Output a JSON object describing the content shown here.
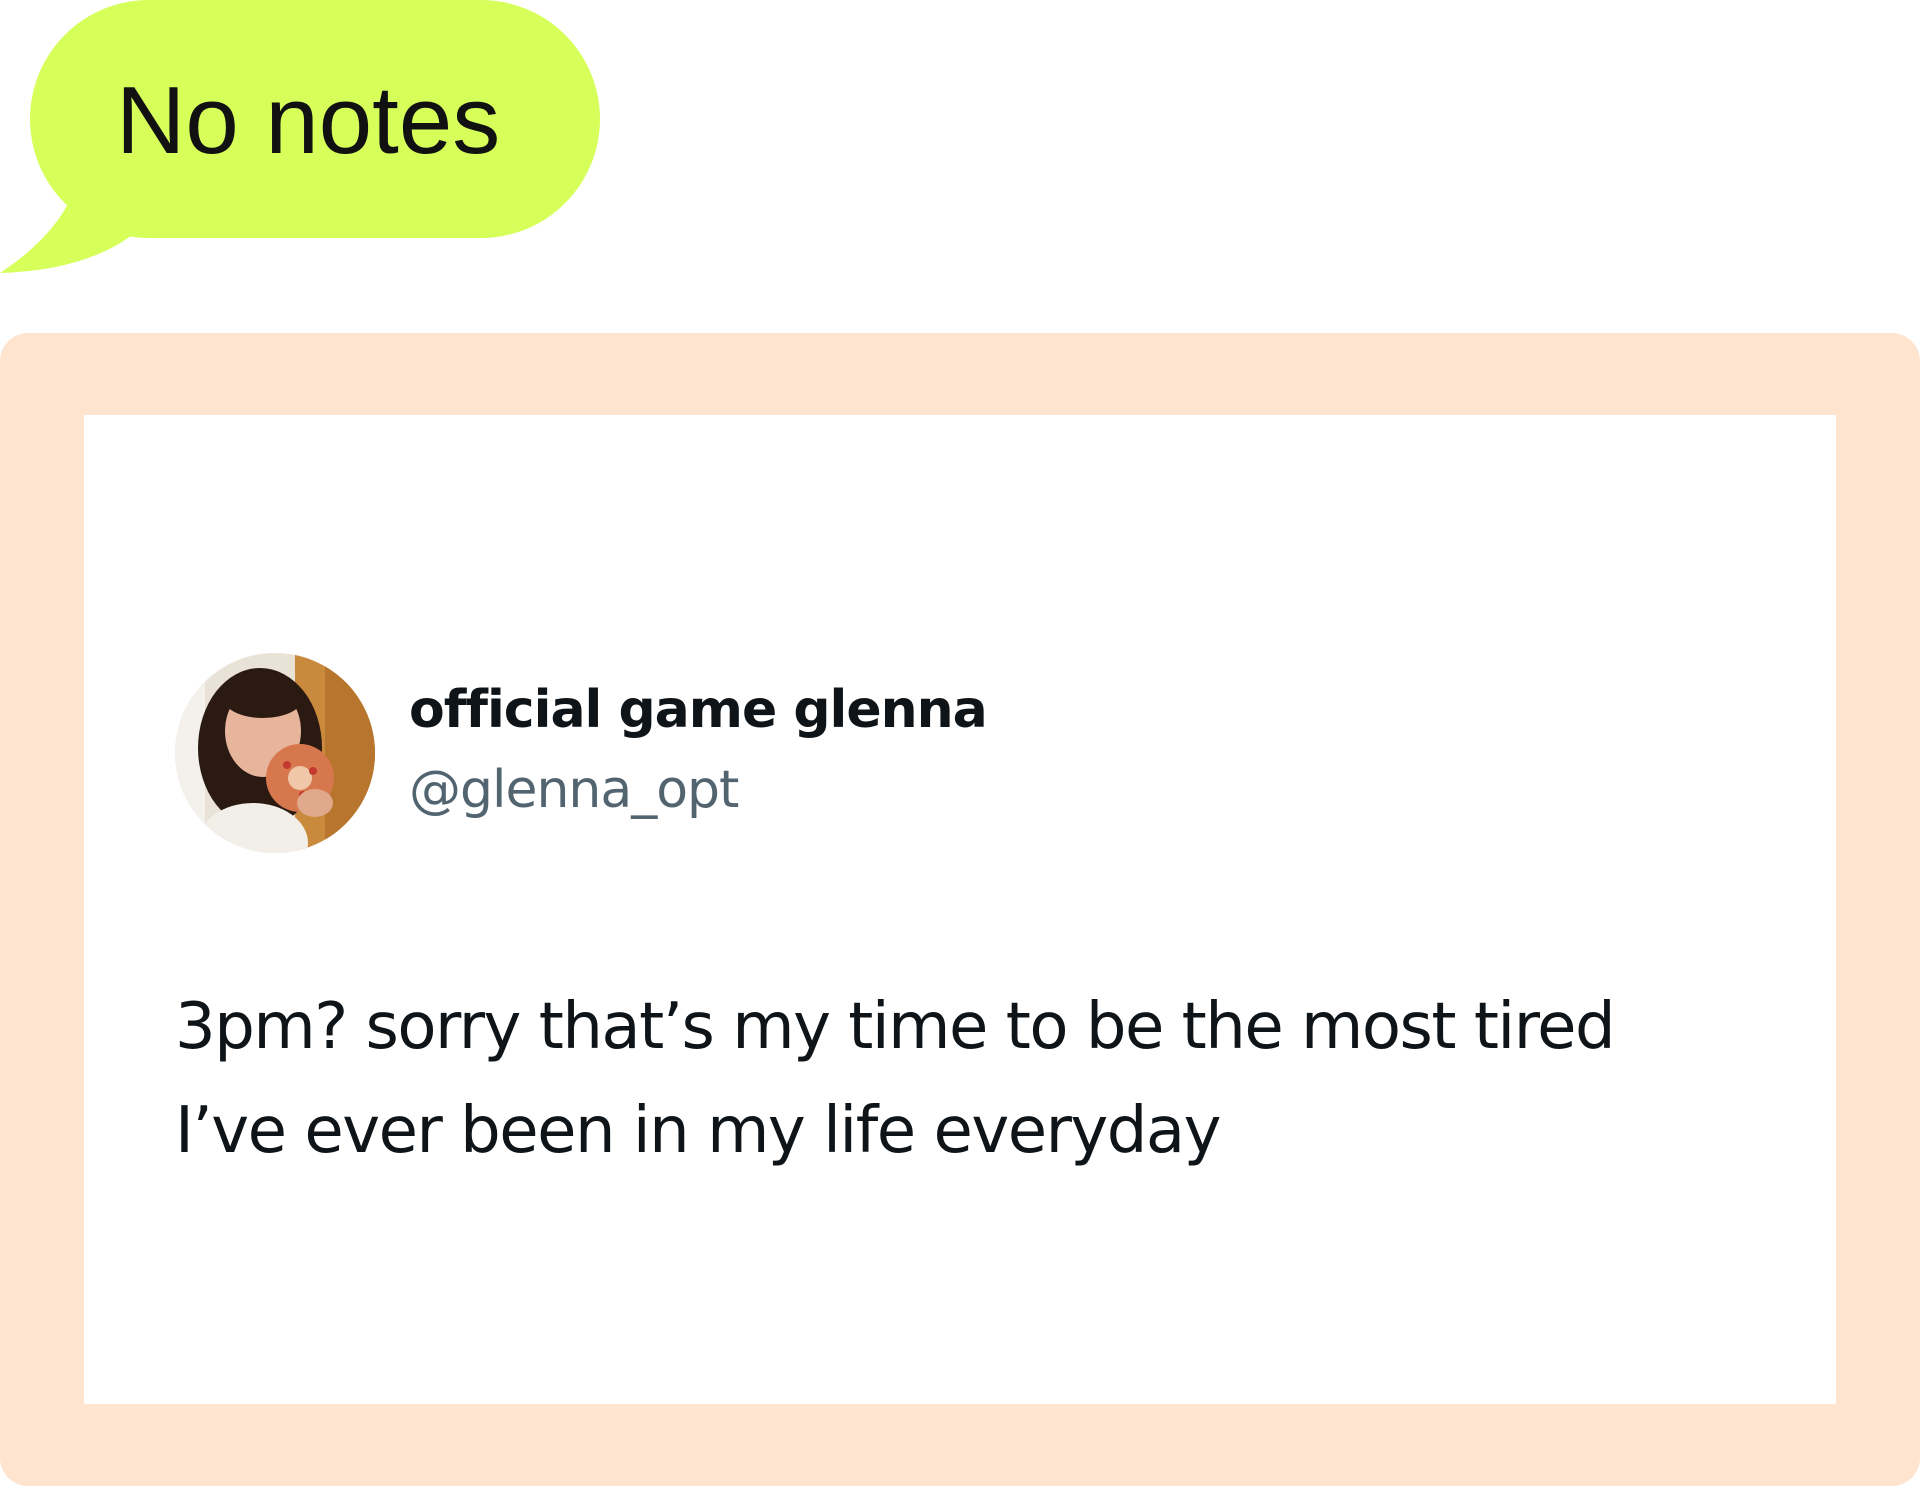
{
  "bubble": {
    "text": "No notes",
    "color": "#d7ff5a"
  },
  "frame": {
    "color": "#ffe4cf"
  },
  "tweet": {
    "display_name": "official game glenna",
    "handle": "@glenna_opt",
    "text_lines": [
      "3pm? sorry that’s my time to be the most tired",
      "I’ve ever been in my life everyday"
    ],
    "avatar_icon": "profile-photo-avatar"
  }
}
